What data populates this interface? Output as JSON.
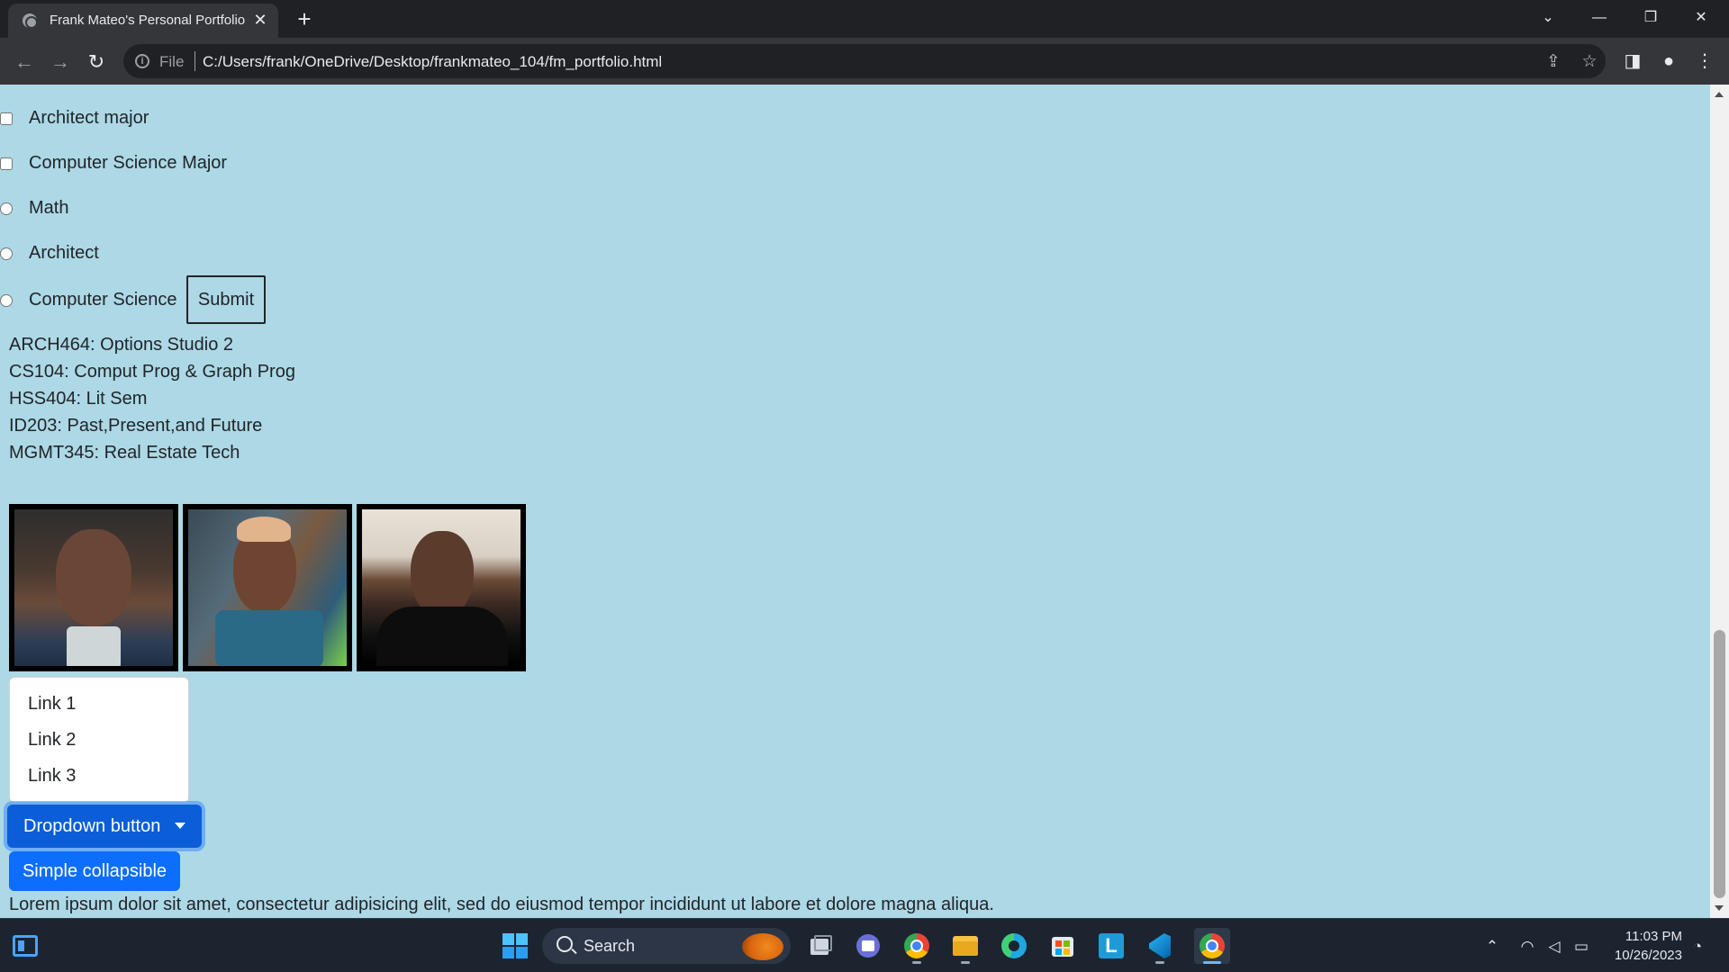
{
  "browser": {
    "tab_title": "Frank Mateo's Personal Portfolio",
    "tab_close": "✕",
    "new_tab": "+",
    "url_scheme": "File",
    "url": "C:/Users/frank/OneDrive/Desktop/frankmateo_104/fm_portfolio.html",
    "window_controls": {
      "minimize": "—",
      "restore": "❐",
      "close": "✕",
      "tab_search": "⌄"
    },
    "icons": [
      "back-icon",
      "forward-icon",
      "reload-icon",
      "info-icon",
      "share-icon",
      "star-icon",
      "side-panel-icon",
      "profile-icon",
      "menu-icon"
    ]
  },
  "page": {
    "options": [
      {
        "type": "checkbox",
        "label": "Architect major",
        "checked": false
      },
      {
        "type": "checkbox",
        "label": "Computer Science Major",
        "checked": false
      },
      {
        "type": "radio",
        "label": "Math",
        "checked": false
      },
      {
        "type": "radio",
        "label": "Architect",
        "checked": false
      },
      {
        "type": "radio",
        "label": "Computer Science",
        "checked": false
      }
    ],
    "submit_label": "Submit",
    "courses": [
      "ARCH464: Options Studio 2",
      "CS104: Comput Prog & Graph Prog",
      "HSS404: Lit Sem",
      "ID203: Past,Present,and Future",
      "MGMT345: Real Estate Tech"
    ],
    "photos": [
      "portrait-photo",
      "portrait-photo",
      "portrait-photo"
    ],
    "dropdown": {
      "items": [
        "Link 1",
        "Link 2",
        "Link 3"
      ],
      "button_label": "Dropdown button"
    },
    "collapse_label": "Simple collapsible",
    "lorem": "Lorem ipsum dolor sit amet, consectetur adipisicing elit, sed do eiusmod tempor incididunt ut labore et dolore magna aliqua.",
    "background_color": "#add8e6",
    "primary_color": "#0d6efd"
  },
  "taskbar": {
    "search_label": "Search",
    "apps": [
      "start-icon",
      "task-view-icon",
      "teams-icon",
      "chrome-icon",
      "file-explorer-icon",
      "edge-icon",
      "store-icon",
      "l-app-icon",
      "vscode-icon",
      "chrome-active-icon"
    ],
    "time": "11:03 PM",
    "date": "10/26/2023"
  }
}
